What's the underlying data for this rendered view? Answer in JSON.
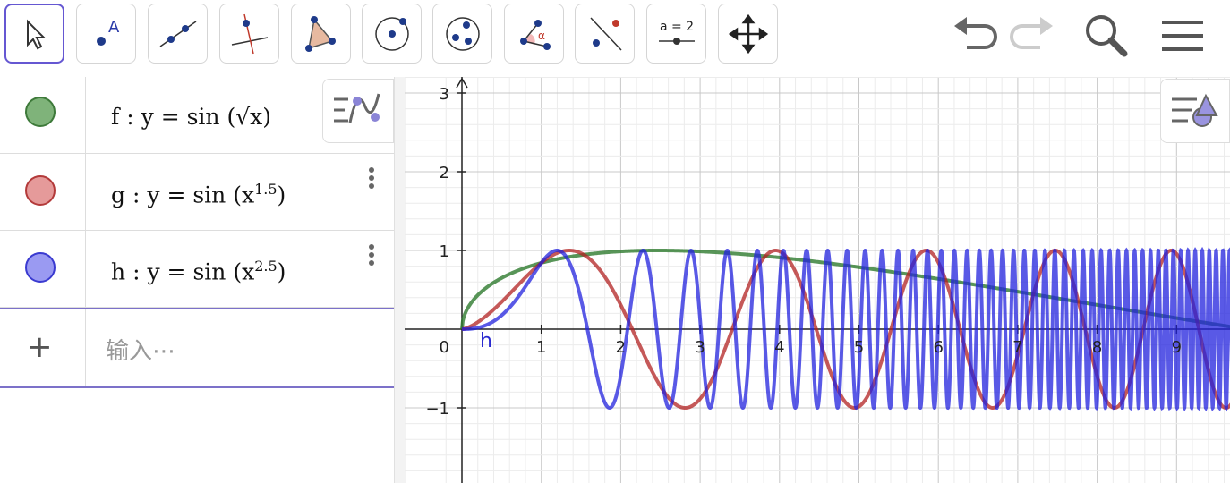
{
  "toolbar": {
    "tools": [
      {
        "name": "move-tool"
      },
      {
        "name": "point-tool",
        "label": "A"
      },
      {
        "name": "line-tool"
      },
      {
        "name": "perpendicular-line-tool"
      },
      {
        "name": "polygon-tool"
      },
      {
        "name": "circle-center-point-tool"
      },
      {
        "name": "circle-three-points-tool"
      },
      {
        "name": "angle-tool",
        "label": "α"
      },
      {
        "name": "reflect-tool"
      },
      {
        "name": "slider-tool",
        "label": "a = 2"
      },
      {
        "name": "move-graphics-view-tool"
      }
    ],
    "right": [
      "undo-icon",
      "redo-icon",
      "search-icon",
      "menu-icon"
    ]
  },
  "algebra": {
    "items": [
      {
        "name": "f",
        "sep": ":",
        "lhs": "y",
        "eq": "=",
        "fn": "sin",
        "arg": "√x",
        "color": "#5a9a55"
      },
      {
        "name": "g",
        "sep": ":",
        "lhs": "y",
        "eq": "=",
        "fn": "sin",
        "base": "x",
        "exp": "1.5",
        "color": "#cc4a4a"
      },
      {
        "name": "h",
        "sep": ":",
        "lhs": "y",
        "eq": "=",
        "fn": "sin",
        "base": "x",
        "exp": "2.5",
        "color": "#4a4ae0"
      }
    ],
    "input_placeholder": "输入⋯",
    "plus": "+"
  },
  "graph": {
    "origin_label": "0",
    "x_ticks": [
      "1",
      "2",
      "3",
      "4",
      "5",
      "6",
      "7",
      "8",
      "9"
    ],
    "y_ticks": [
      "3",
      "2",
      "1",
      "−1"
    ],
    "point_label": "h",
    "colors": {
      "f": "#2e7a2e",
      "g": "#b22222",
      "h": "#2222dd"
    }
  }
}
